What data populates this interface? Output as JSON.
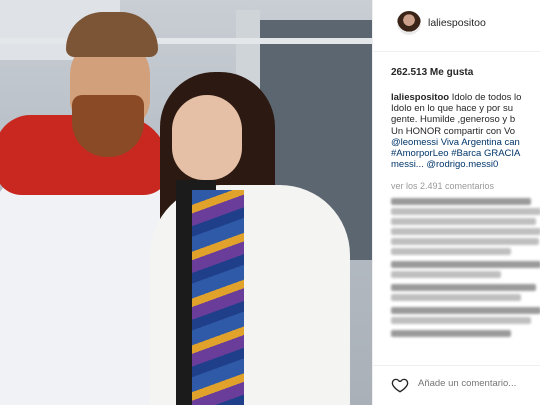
{
  "post": {
    "username": "laliespositoo",
    "likes": "262.513 Me gusta",
    "caption": {
      "user": "laliespositoo",
      "lines": [
        " Idolo de todos lo",
        "Idolo en lo que hace y por su",
        "gente. Humilde ,generoso y b",
        "Un HONOR compartir con Vo",
        "@leomessi Viva Argentina can",
        "#AmorporLeo #Barca GRACIA",
        "messi... @rodrigo.messi0"
      ]
    },
    "view_comments": "ver los 2.491 comentarios",
    "add_comment_placeholder": "Añade un comentario..."
  },
  "icons": {
    "like": "heart-icon",
    "avatar": "avatar"
  },
  "colors": {
    "link": "#003569",
    "muted": "#999999",
    "text": "#262626"
  }
}
